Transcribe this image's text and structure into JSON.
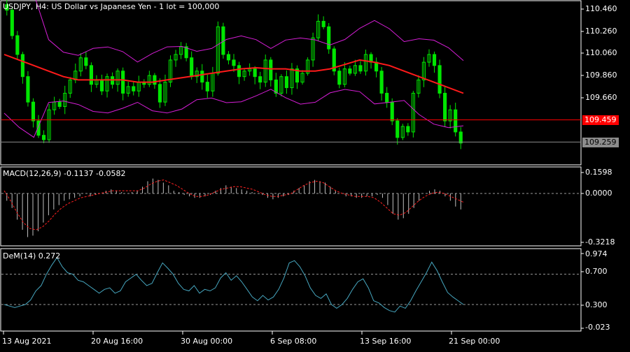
{
  "window": {
    "symbol_info": "USDJPY, H4:  US Dollar vs Japanese Yen - 1 lot = 100,000"
  },
  "price_panel": {
    "axis_labels": [
      "110.460",
      "110.260",
      "110.060",
      "109.860",
      "109.660"
    ],
    "red_line_label": "109.459",
    "bid_label": "109.259",
    "colors": {
      "candle": "#00e600",
      "ma": "#ff1a1a",
      "bands": "#d61ed6",
      "bid_line": "#8c8c8c",
      "red_line": "#ff0000"
    }
  },
  "macd_panel": {
    "info": "MACD(12,26,9) -0.1137 -0.0582",
    "axis_labels": [
      "0.1598",
      "0.0000",
      "-0.3218"
    ],
    "colors": {
      "hist": "#c0c0c0",
      "signal": "#ff2020"
    }
  },
  "dem_panel": {
    "info": "DeM(14) 0.272",
    "axis_labels": [
      "0.974",
      "0.700",
      "0.300",
      "-0.023"
    ],
    "colors": {
      "line": "#46a6bf",
      "level": "#9a9a9a"
    }
  },
  "time_axis": [
    "13 Aug 2021",
    "20 Aug 16:00",
    "30 Aug 00:00",
    "6 Sep 08:00",
    "13 Sep 16:00",
    "21 Sep 00:00"
  ],
  "chart_data": [
    {
      "type": "candlestick",
      "title": "USDJPY, H4:  US Dollar vs Japanese Yen - 1 lot = 100,000",
      "ylim": [
        109.24,
        110.48
      ],
      "y_ticks": [
        110.46,
        110.26,
        110.06,
        109.86,
        109.66
      ],
      "close_series_approx": [
        110.45,
        110.22,
        110.05,
        109.85,
        109.62,
        109.45,
        109.32,
        109.28,
        109.55,
        109.62,
        109.58,
        109.7,
        109.82,
        109.9,
        110.02,
        109.95,
        109.78,
        109.82,
        109.72,
        109.85,
        109.78,
        109.9,
        109.7,
        109.76,
        109.72,
        109.8,
        109.78,
        109.86,
        109.78,
        109.62,
        109.8,
        110.0,
        110.05,
        110.12,
        110.02,
        109.85,
        109.9,
        109.8,
        109.72,
        109.88,
        110.3,
        110.05,
        110.0,
        109.95,
        109.85,
        109.9,
        109.92,
        109.85,
        109.8,
        110.0,
        109.82,
        109.7,
        109.85,
        109.75,
        109.92,
        109.8,
        109.88,
        110.0,
        110.2,
        110.35,
        110.3,
        110.1,
        109.9,
        109.78,
        109.92,
        109.88,
        109.95,
        109.9,
        110.05,
        109.98,
        109.9,
        109.7,
        109.62,
        109.45,
        109.3,
        109.4,
        109.35,
        109.7,
        109.82,
        109.98,
        110.05,
        109.95,
        109.7,
        109.45,
        109.55,
        109.35,
        109.25
      ],
      "moving_average_approx": [
        110.05,
        110.0,
        109.95,
        109.9,
        109.85,
        109.82,
        109.82,
        109.82,
        109.82,
        109.8,
        109.8,
        109.82,
        109.84,
        109.86,
        109.88,
        109.9,
        109.92,
        109.93,
        109.92,
        109.92,
        109.9,
        109.9,
        109.92,
        109.96,
        110.0,
        109.98,
        109.95,
        109.9,
        109.85,
        109.8,
        109.75,
        109.7
      ],
      "horizontal_lines": [
        109.459,
        109.259
      ]
    },
    {
      "type": "bar",
      "title": "MACD(12,26,9) -0.1137 -0.0582",
      "ylim": [
        -0.3218,
        0.1598
      ],
      "histogram_approx": [
        -0.05,
        -0.1,
        -0.18,
        -0.25,
        -0.3,
        -0.29,
        -0.26,
        -0.2,
        -0.15,
        -0.11,
        -0.08,
        -0.05,
        -0.04,
        -0.03,
        -0.02,
        0.0,
        -0.02,
        -0.01,
        0.0,
        0.02,
        0.03,
        0.02,
        0.01,
        0.0,
        0.01,
        0.02,
        0.05,
        0.09,
        0.11,
        0.1,
        0.08,
        0.06,
        0.02,
        0.01,
        -0.01,
        -0.02,
        -0.03,
        -0.03,
        -0.02,
        -0.01,
        0.02,
        0.04,
        0.06,
        0.05,
        0.04,
        0.03,
        0.02,
        0.01,
        0.0,
        -0.01,
        -0.03,
        -0.04,
        -0.03,
        -0.02,
        -0.01,
        0.02,
        0.04,
        0.06,
        0.09,
        0.1,
        0.09,
        0.08,
        0.05,
        0.02,
        0.0,
        -0.02,
        -0.02,
        -0.03,
        -0.03,
        -0.02,
        -0.02,
        -0.01,
        -0.03,
        -0.08,
        -0.14,
        -0.18,
        -0.17,
        -0.14,
        -0.1,
        -0.05,
        0.0,
        0.02,
        0.03,
        0.02,
        -0.02,
        -0.05,
        -0.09,
        -0.11
      ],
      "signal_approx": [
        0.02,
        -0.05,
        -0.13,
        -0.2,
        -0.24,
        -0.25,
        -0.23,
        -0.19,
        -0.14,
        -0.1,
        -0.07,
        -0.05,
        -0.03,
        -0.02,
        -0.01,
        0.0,
        0.01,
        0.02,
        0.02,
        0.02,
        0.02,
        0.02,
        0.04,
        0.07,
        0.09,
        0.1,
        0.08,
        0.06,
        0.03,
        0.0,
        -0.02,
        -0.02,
        -0.01,
        0.01,
        0.03,
        0.04,
        0.05,
        0.05,
        0.04,
        0.03,
        0.01,
        -0.01,
        -0.02,
        -0.02,
        -0.01,
        0.0,
        0.03,
        0.06,
        0.08,
        0.09,
        0.08,
        0.05,
        0.02,
        0.0,
        -0.01,
        -0.02,
        -0.02,
        -0.02,
        -0.03,
        -0.06,
        -0.1,
        -0.14,
        -0.15,
        -0.13,
        -0.09,
        -0.05,
        -0.02,
        0.0,
        0.01,
        0.0,
        -0.02,
        -0.04,
        -0.06
      ]
    },
    {
      "type": "line",
      "title": "DeM(14) 0.272",
      "ylim": [
        -0.023,
        0.974
      ],
      "levels": [
        0.7,
        0.3
      ],
      "values_approx": [
        0.3,
        0.28,
        0.26,
        0.28,
        0.3,
        0.36,
        0.48,
        0.55,
        0.7,
        0.82,
        0.92,
        0.8,
        0.72,
        0.7,
        0.62,
        0.6,
        0.55,
        0.5,
        0.45,
        0.5,
        0.52,
        0.45,
        0.48,
        0.6,
        0.65,
        0.7,
        0.62,
        0.55,
        0.58,
        0.72,
        0.85,
        0.78,
        0.7,
        0.58,
        0.5,
        0.48,
        0.55,
        0.45,
        0.5,
        0.48,
        0.52,
        0.65,
        0.72,
        0.62,
        0.68,
        0.6,
        0.5,
        0.4,
        0.35,
        0.42,
        0.36,
        0.4,
        0.5,
        0.65,
        0.85,
        0.88,
        0.8,
        0.68,
        0.52,
        0.42,
        0.38,
        0.44,
        0.3,
        0.25,
        0.3,
        0.38,
        0.5,
        0.6,
        0.64,
        0.52,
        0.35,
        0.32,
        0.26,
        0.22,
        0.2,
        0.28,
        0.25,
        0.35,
        0.48,
        0.6,
        0.72,
        0.86,
        0.75,
        0.6,
        0.46,
        0.4,
        0.35,
        0.3
      ]
    }
  ]
}
